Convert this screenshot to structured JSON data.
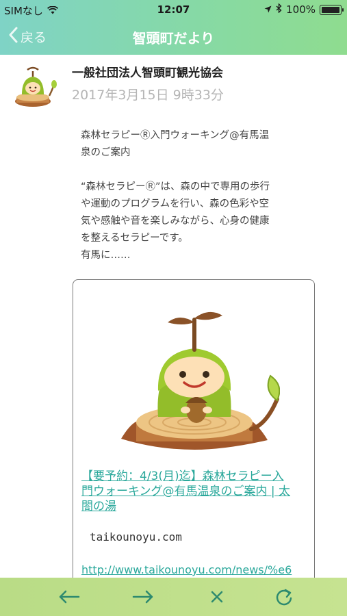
{
  "status_bar": {
    "carrier": "SIMなし",
    "time": "12:07",
    "battery": "100%",
    "icons": [
      "wifi-icon",
      "location-arrow-icon",
      "bluetooth-icon",
      "battery-icon"
    ]
  },
  "nav": {
    "back_label": "戻る",
    "title": "智頭町だより"
  },
  "post": {
    "author": "一般社団法人智頭町観光協会",
    "date": "2017年3月15日 9時33分",
    "body": {
      "line1": "森林セラピーⓇ入門ウォーキング@有馬温",
      "line2": "泉のご案内",
      "line3": "“森林セラピーⓇ”は、森の中で専用の歩行",
      "line4": "や運動のプログラムを行い、森の色彩や空",
      "line5": "気や感触や音を楽しみながら、心身の健康",
      "line6": "を整えるセラピーです。",
      "line7": "有馬に……"
    }
  },
  "link_card": {
    "title_line1": "【要予約：4/3(月)迄】森林セラピー入",
    "title_line2": "門ウォーキング@有馬温泉のご案内 | 太",
    "title_line3": "閤の湯",
    "domain": "taikounoyu.com",
    "url": "http://www.taikounoyu.com/news/%e6"
  },
  "toolbar": {
    "icons": [
      "back-arrow-icon",
      "forward-arrow-icon",
      "close-icon",
      "reload-icon"
    ]
  },
  "colors": {
    "accent": "#2aa89b",
    "nav_gradient_start": "#7fd3c6",
    "nav_gradient_end": "#8fdc8f",
    "toolbar_bg": "#bfe08b",
    "toolbar_icon": "#2d8a6f"
  }
}
